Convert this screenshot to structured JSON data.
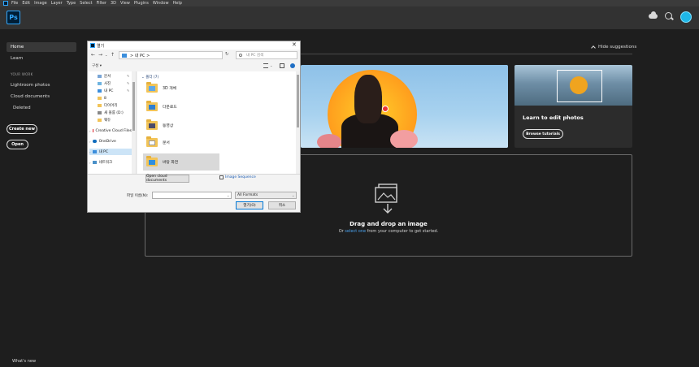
{
  "menubar": {
    "items": [
      "File",
      "Edit",
      "Image",
      "Layer",
      "Type",
      "Select",
      "Filter",
      "3D",
      "View",
      "Plugins",
      "Window",
      "Help"
    ]
  },
  "app": {
    "logo": "Ps"
  },
  "sidebar": {
    "items": [
      {
        "label": "Home",
        "active": true
      },
      {
        "label": "Learn",
        "active": false
      }
    ],
    "section_label": "YOUR WORK",
    "work_items": [
      "Lightroom photos",
      "Cloud documents",
      "Deleted"
    ],
    "create_new": "Create new",
    "open": "Open",
    "whats_new": "What's new"
  },
  "main": {
    "hide_suggestions": "Hide suggestions",
    "learn_card": {
      "title": "Learn to edit photos",
      "button": "Browse tutorials"
    },
    "drop_zone": {
      "title": "Drag and drop an image",
      "sub_prefix": "Or ",
      "sub_link": "select one",
      "sub_suffix": " from your computer to get started."
    }
  },
  "dialog": {
    "title": "열기",
    "close": "✕",
    "address": "내 PC",
    "address_sep": ">",
    "search_placeholder": "내 PC 검색",
    "organize": "구성 ▾",
    "nav_items": [
      {
        "label": "문서",
        "icon": "documents-icon",
        "pinned": true
      },
      {
        "label": "사진",
        "icon": "pictures-icon",
        "pinned": true
      },
      {
        "label": "내 PC",
        "icon": "this-pc-icon",
        "pinned": true
      },
      {
        "label": "8",
        "icon": "folder-icon",
        "pinned": false
      },
      {
        "label": "다이어리",
        "icon": "folder-icon",
        "pinned": false
      },
      {
        "label": "새 볼륨 (D:)",
        "icon": "drive-icon",
        "pinned": false
      },
      {
        "label": "웨듀",
        "icon": "folder-icon",
        "pinned": false
      },
      {
        "label": "Creative Cloud Files",
        "icon": "creative-cloud-icon",
        "pinned": false
      },
      {
        "label": "OneDrive",
        "icon": "onedrive-icon",
        "pinned": false
      },
      {
        "label": "내 PC",
        "icon": "this-pc-icon",
        "pinned": false,
        "selected": true
      },
      {
        "label": "네트워크",
        "icon": "network-icon",
        "pinned": false
      }
    ],
    "group_header": "폴더 (7)",
    "folders": [
      {
        "name": "3D 개체",
        "badge": "3d-icon",
        "selected": false
      },
      {
        "name": "다운로드",
        "badge": "download-icon",
        "selected": false
      },
      {
        "name": "동영상",
        "badge": "video-icon",
        "selected": false
      },
      {
        "name": "문서",
        "badge": "document-icon",
        "selected": false
      },
      {
        "name": "바탕 화면",
        "badge": "desktop-icon",
        "selected": true
      }
    ],
    "open_cloud_documents": "Open cloud documents",
    "image_sequence": "Image Sequence",
    "filename_label": "파일 이름(N):",
    "filename_value": "",
    "format_value": "All Formats",
    "open_button": "열기(O)",
    "cancel_button": "취소"
  },
  "colors": {
    "accent": "#31a8ff",
    "app_bg": "#1e1e1e",
    "link": "#4aa3f0"
  }
}
